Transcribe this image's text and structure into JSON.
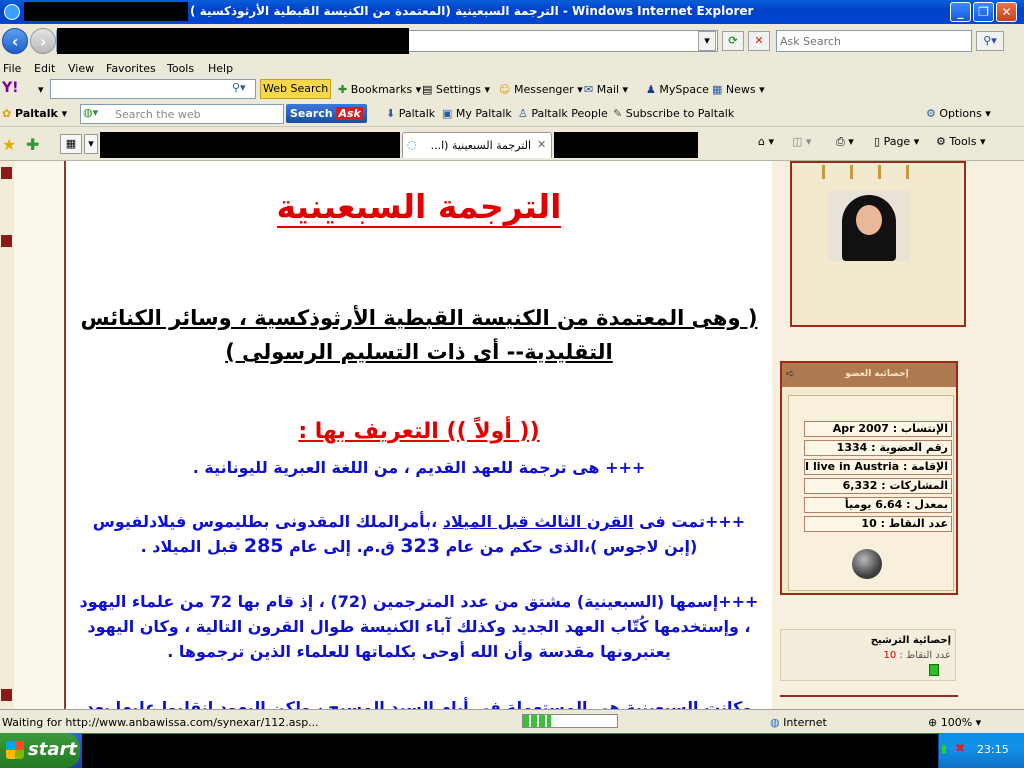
{
  "window": {
    "title": "الترجمة السبعينية (المعتمدة من الكنيسة القبطية الأرثوذكسية ) - Windows Internet Explorer",
    "controls": [
      "_",
      "❐",
      "✕"
    ]
  },
  "address": {
    "search_placeholder": "Ask Search"
  },
  "menu": [
    "File",
    "Edit",
    "View",
    "Favorites",
    "Tools",
    "Help"
  ],
  "yahoo_toolbar": {
    "web_search": "Web Search",
    "bookmarks": "Bookmarks",
    "settings": "Settings",
    "messenger": "Messenger",
    "mail": "Mail",
    "myspace": "MySpace",
    "news": "News"
  },
  "paltalk_toolbar": {
    "brand": "Paltalk",
    "search_placeholder": "Search the web",
    "search_button": "Search",
    "ask": "Ask",
    "paltalk": "Paltalk",
    "my_paltalk": "My Paltalk",
    "paltalk_people": "Paltalk People",
    "subscribe": "Subscribe to Paltalk",
    "options": "Options"
  },
  "tabs": {
    "active_label": "الترجمة السبعينية (ا...",
    "page": "Page",
    "tools": "Tools"
  },
  "article": {
    "title": "الترجمة السبعينية",
    "subtitle": "( وهى المعتمدة من الكنيسة القبطية الأرثوذكسية ، وسائر الكنائس التقليدية-- أى ذات التسليم الرسولى )",
    "section_heading": "(( أولاً )) التعريف بها :",
    "p1": "+++ هى ترجمة للعهد القديم ، من اللغة العبرية لليونانية .",
    "p2_a": "+++تمت فى ",
    "p2_ul": "القرن الثالث قبل الميلاد",
    "p2_b": " ،بأمرالملك المقدونى بطليموس فيلادلفيوس (إبن لاجوس )،الذى حكم من عام ",
    "p2_n1": "323",
    "p2_c": " ق.م. إلى عام ",
    "p2_n2": "285",
    "p2_d": " قبل الميلاد .",
    "p3": "+++إسمها (السبعينية) مشتق من عدد المترجمين (72) ، إذ قام بها 72 من علماء اليهود ، وإستخدمها كُتّاب العهد الجديد وكذلك آباء الكنيسة طوال القرون التالية ، وكان اليهود يعتبرونها مقدسة وأن الله أوحى بكلماتها للعلماء الذين ترجموها .",
    "p4": "وكانت السبعينية هى المستعملة فى أيام السيد المسيح ، ولكن اليهود إنقلبوا عليها بعد قيامة"
  },
  "member_stats": {
    "header": "إحصائية العضو",
    "rows": [
      "الإنتساب : Apr 2007",
      "رقم العضوية : 1334",
      "الإقامة : I live in Austria",
      "المشاركات : 6,332",
      "بمعدل : 6.64 يومياً",
      "عدد النقاط : 10"
    ]
  },
  "nomination": {
    "title": "إحصائية الترشيح",
    "points_label": "عدد النقاط :",
    "points_value": "10"
  },
  "status": {
    "text": "Waiting for http://www.anbawissa.com/synexar/112.asp...",
    "progress": 0.3,
    "zone": "Internet",
    "zoom": "100%"
  },
  "taskbar": {
    "start": "start",
    "clock": "23:15"
  }
}
